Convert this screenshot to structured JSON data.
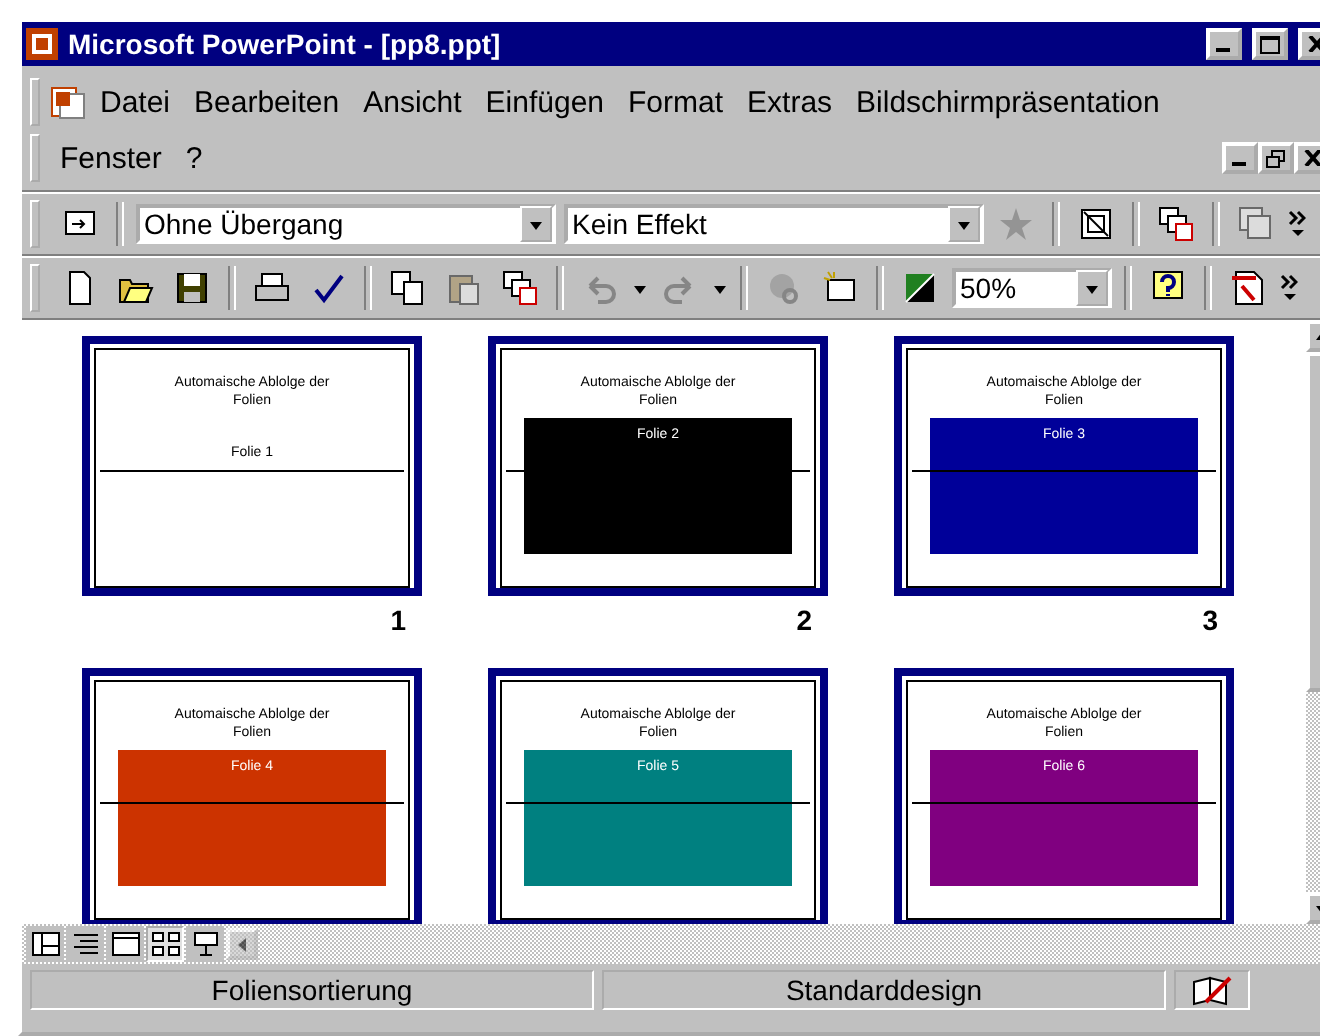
{
  "window": {
    "title": "Microsoft PowerPoint - [pp8.ppt]"
  },
  "menu": {
    "items": [
      "Datei",
      "Bearbeiten",
      "Ansicht",
      "Einfügen",
      "Format",
      "Extras",
      "Bildschirmpräsentation"
    ],
    "second_row": [
      "Fenster",
      "?"
    ]
  },
  "formatting_toolbar": {
    "transition": "Ohne Übergang",
    "effect": "Kein Effekt"
  },
  "standard_toolbar": {
    "zoom": "50%"
  },
  "slides": [
    {
      "title": "Automaische Ablolge der Folien",
      "label": "Folie 1",
      "number": "1",
      "color": "#ffffff"
    },
    {
      "title": "Automaische Ablolge der Folien",
      "label": "Folie 2",
      "number": "2",
      "color": "#000000"
    },
    {
      "title": "Automaische Ablolge der Folien",
      "label": "Folie 3",
      "number": "3",
      "color": "#000099"
    },
    {
      "title": "Automaische Ablolge der Folien",
      "label": "Folie 4",
      "color": "#cc3300"
    },
    {
      "title": "Automaische Ablolge der Folien",
      "label": "Folie 5",
      "color": "#008080"
    },
    {
      "title": "Automaische Ablolge der Folien",
      "label": "Folie 6",
      "color": "#800080"
    }
  ],
  "view_buttons": [
    {
      "kind": "normal",
      "selected": false
    },
    {
      "kind": "outline",
      "selected": false
    },
    {
      "kind": "slide",
      "selected": false
    },
    {
      "kind": "sorter",
      "selected": true
    },
    {
      "kind": "show",
      "selected": false
    }
  ],
  "status_bar": {
    "view": "Foliensortierung",
    "design": "Standarddesign"
  }
}
